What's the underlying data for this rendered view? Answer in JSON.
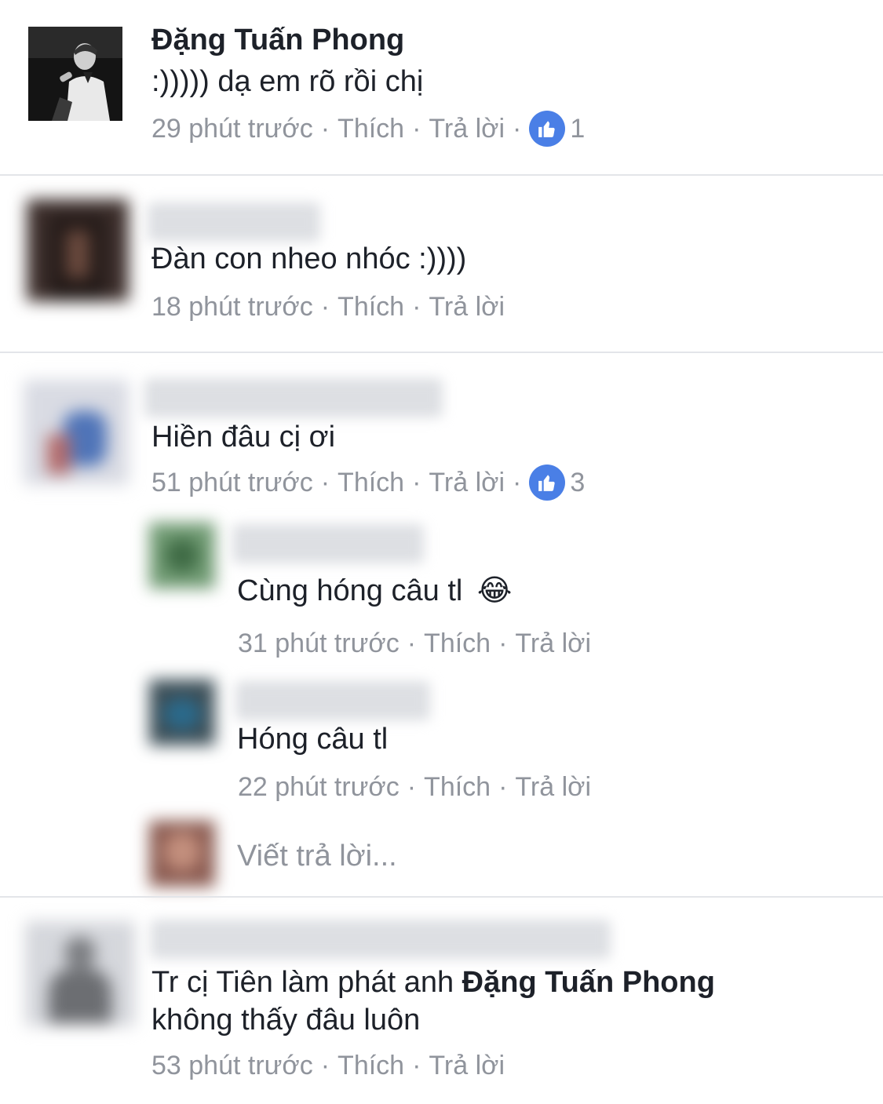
{
  "comments": [
    {
      "name": "Đặng Tuấn Phong",
      "text": ":))))) dạ em rõ rồi chị",
      "time": "29 phút trước",
      "like_label": "Thích",
      "reply_label": "Trả lời",
      "likes": "1"
    },
    {
      "text": "Đàn con nheo nhóc :))))",
      "time": "18 phút trước",
      "like_label": "Thích",
      "reply_label": "Trả lời"
    },
    {
      "text": "Hiền đâu cị ơi",
      "time": "51 phút trước",
      "like_label": "Thích",
      "reply_label": "Trả lời",
      "likes": "3",
      "replies": [
        {
          "text": "Cùng hóng câu tl",
          "emoji": "😂",
          "time": "31 phút trước",
          "like_label": "Thích",
          "reply_label": "Trả lời"
        },
        {
          "text": "Hóng câu tl",
          "time": "22 phút trước",
          "like_label": "Thích",
          "reply_label": "Trả lời"
        }
      ],
      "reply_placeholder": "Viết trả lời..."
    },
    {
      "text_before": "Tr cị Tiên làm phát anh ",
      "mention": "Đặng Tuấn Phong",
      "text_after": "không thấy đâu luôn",
      "time": "53 phút trước",
      "like_label": "Thích",
      "reply_label": "Trả lời"
    }
  ],
  "colors": {
    "meta": "#90949c",
    "like_blue": "#4a7fe6",
    "text": "#1d2129"
  },
  "icons": {
    "like": "thumbs-up-icon"
  }
}
